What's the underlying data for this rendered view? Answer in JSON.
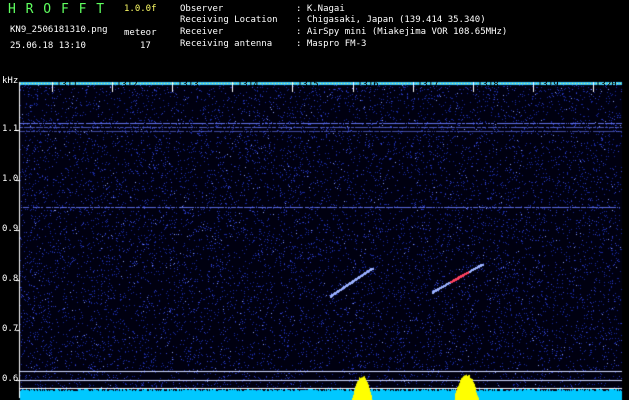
{
  "header": {
    "app_title": "H R O F F T",
    "version": "1.0.0f",
    "filename": "KN9_2506181310.png",
    "datetime": "25.06.18 13:10",
    "meteor_label": "meteor",
    "meteor_count": "17",
    "fields": [
      {
        "label": "Observer",
        "value": ": K.Nagai"
      },
      {
        "label": "Receiving Location",
        "value": ": Chigasaki, Japan (139.414 35.340)"
      },
      {
        "label": "Receiver",
        "value": ": AirSpy mini (Miakejima VOR 108.65MHz)"
      },
      {
        "label": "Receiving antenna",
        "value": ": Maspro FM-3"
      }
    ]
  },
  "spectrogram": {
    "y_unit": "kHz",
    "y_ticks": [
      "1.1",
      "1.0",
      "0.9",
      "0.8",
      "0.7",
      "0.6"
    ],
    "x_ticks": [
      "1311",
      "1312",
      "1313",
      "1314",
      "1315",
      "1316",
      "1317",
      "1318",
      "1319",
      "1320"
    ],
    "colors": {
      "background": "#000010",
      "noise": "#1a2aa0",
      "line": "#6a7cff",
      "meteor": "#ff4060",
      "power_base": "#00c8ff",
      "power_peak": "#ffff00"
    }
  }
}
